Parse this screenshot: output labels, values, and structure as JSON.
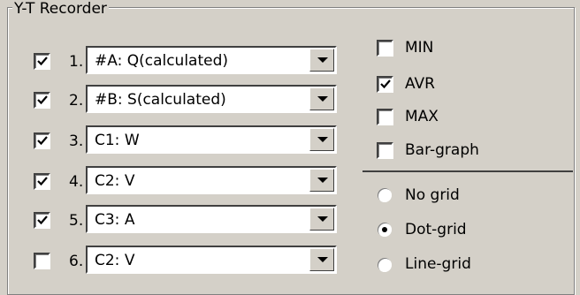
{
  "group": {
    "title": "Y-T Recorder"
  },
  "channels": [
    {
      "index": "1.",
      "checked": true,
      "value": "#A: Q(calculated)"
    },
    {
      "index": "2.",
      "checked": true,
      "value": "#B: S(calculated)"
    },
    {
      "index": "3.",
      "checked": true,
      "value": "C1: W"
    },
    {
      "index": "4.",
      "checked": true,
      "value": "C2: V"
    },
    {
      "index": "5.",
      "checked": true,
      "value": "C3: A"
    },
    {
      "index": "6.",
      "checked": false,
      "value": "C2: V"
    }
  ],
  "options": [
    {
      "label": "MIN",
      "checked": false
    },
    {
      "label": "AVR",
      "checked": true
    },
    {
      "label": "MAX",
      "checked": false
    },
    {
      "label": "Bar-graph",
      "checked": false
    }
  ],
  "grid": {
    "options": [
      {
        "label": "No grid",
        "selected": false
      },
      {
        "label": "Dot-grid",
        "selected": true
      },
      {
        "label": "Line-grid",
        "selected": false
      }
    ]
  },
  "icons": {
    "checkmark": "checkmark-icon",
    "dropdown": "chevron-down-icon",
    "radio_dot": "radio-dot-icon"
  },
  "colors": {
    "face": "#d4d0c8",
    "field": "#ffffff",
    "shadow": "#808080",
    "dark_shadow": "#404040"
  }
}
